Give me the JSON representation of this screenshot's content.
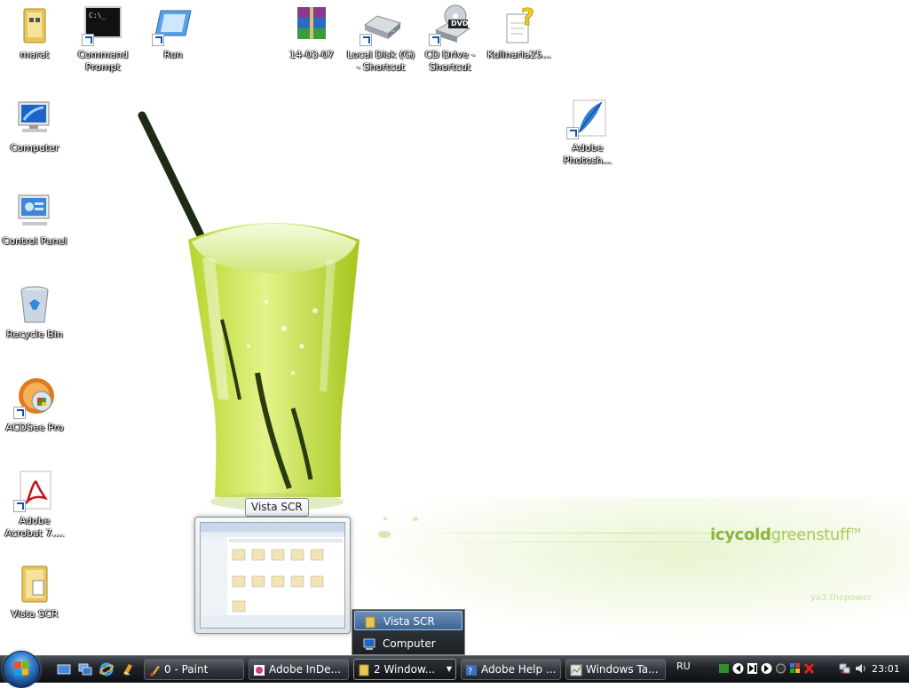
{
  "desktop": {
    "icons": [
      {
        "name": "marat",
        "shortcut": false
      },
      {
        "name": "Command Prompt",
        "shortcut": true
      },
      {
        "name": "Run",
        "shortcut": true
      },
      {
        "name": "14-03-07",
        "shortcut": false
      },
      {
        "name": "Local Disk (G) - Shortcut",
        "shortcut": true
      },
      {
        "name": "CD Drive - Shortcut",
        "shortcut": true
      },
      {
        "name": "Kulinaria25...",
        "shortcut": false
      },
      {
        "name": "Adobe Photosh...",
        "shortcut": true
      },
      {
        "name": "Computer",
        "shortcut": false
      },
      {
        "name": "Control Panel",
        "shortcut": false
      },
      {
        "name": "Recycle Bin",
        "shortcut": false
      },
      {
        "name": "ACDSee Pro",
        "shortcut": true
      },
      {
        "name": "Adobe Acrobat 7....",
        "shortcut": true
      },
      {
        "name": "Vista SCR",
        "shortcut": false
      }
    ],
    "wallpaper_brand": {
      "bold": "icycold",
      "rest": "greenstuff",
      "tm": "TM",
      "sub": "ya3.thepower"
    },
    "cd_label": "DVD"
  },
  "thumbnail": {
    "title": "Vista SCR"
  },
  "group_menu": {
    "items": [
      {
        "label": "Vista SCR",
        "icon": "folder-icon",
        "selected": true
      },
      {
        "label": "Computer",
        "icon": "computer-icon",
        "selected": false
      }
    ]
  },
  "taskbar": {
    "quick_launch": [
      "show-desktop-icon",
      "switch-windows-icon",
      "internet-explorer-icon",
      "media-icon"
    ],
    "buttons": [
      {
        "label": "0 - Paint",
        "icon": "paint-icon",
        "active": false
      },
      {
        "label": "Adobe InDe...",
        "icon": "indesign-icon",
        "active": false
      },
      {
        "label": "2 Window...",
        "icon": "folder-icon",
        "active": true
      },
      {
        "label": "Adobe Help ...",
        "icon": "help-icon",
        "active": false
      },
      {
        "label": "Windows Ta...",
        "icon": "task-manager-icon",
        "active": false
      }
    ],
    "language": "RU",
    "clock": "23:01"
  },
  "colors": {
    "taskbar_dark": "#1e2227",
    "accent_green": "#a7c957",
    "selection_blue": "#3c6694"
  }
}
